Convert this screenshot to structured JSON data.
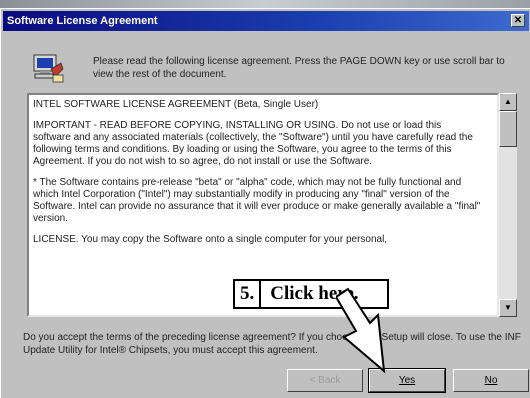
{
  "window": {
    "title": "Software License Agreement",
    "close_label": "✕"
  },
  "intro": {
    "text": "Please read the following license agreement. Press the PAGE DOWN key or use scroll bar to view the rest of the document."
  },
  "license": {
    "paragraphs": [
      "INTEL SOFTWARE LICENSE AGREEMENT (Beta, Single User)",
      "IMPORTANT - READ BEFORE COPYING, INSTALLING OR USING. Do not use or load this software and any associated materials (collectively, the \"Software\") until you have carefully read the following terms and conditions. By loading or using the Software, you agree to the terms of this Agreement. If you do not wish to so agree, do not install or use the Software.",
      "* The Software contains pre-release \"beta\" or \"alpha\" code, which may not be fully functional and which Intel Corporation (\"Intel\") may substantially modify in producing any \"final\" version of the Software. Intel can provide no assurance that it will ever produce or make generally available a \"final\" version.",
      "LICENSE. You may copy the Software onto a single computer for your personal,"
    ]
  },
  "callout": {
    "step": "5.",
    "label": "Click here."
  },
  "question": {
    "text": "Do you accept the terms of the preceding license agreement? If you choose NO, Setup will close. To use the INF Update Utility for Intel® Chipsets, you must accept this agreement."
  },
  "buttons": {
    "back": "< Back",
    "yes": "Yes",
    "no": "No"
  }
}
